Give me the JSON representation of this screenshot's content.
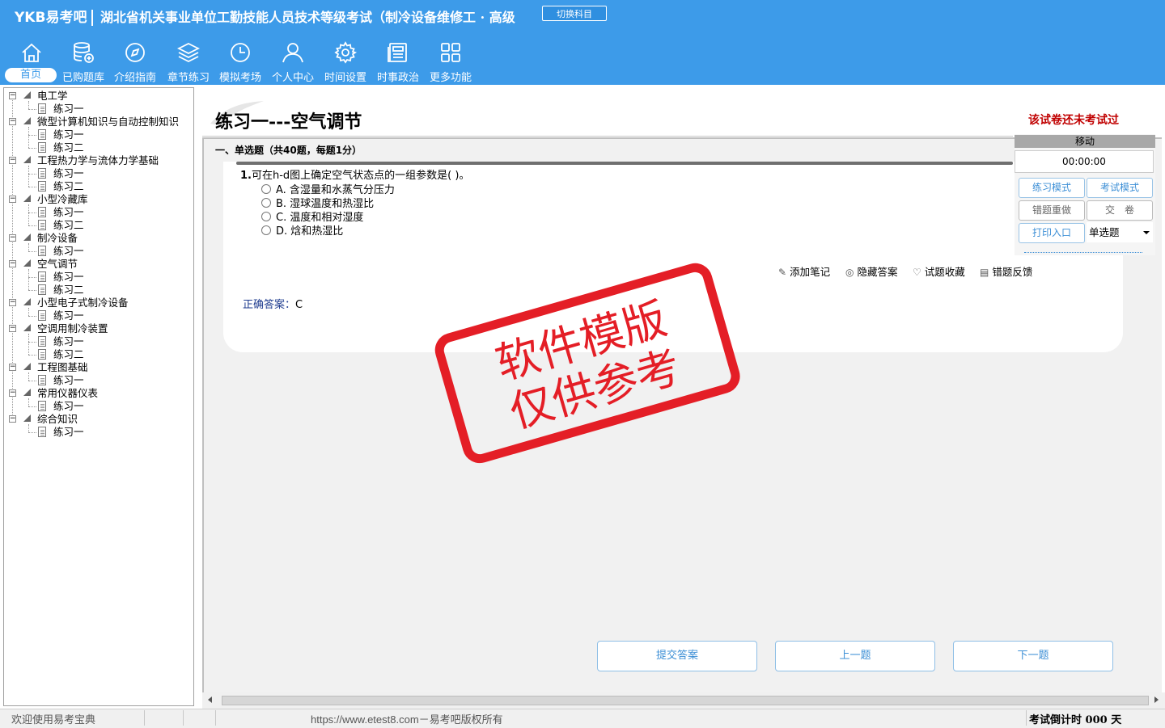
{
  "header": {
    "brand": "YKB易考吧",
    "exam_title": "湖北省机关事业单位工勤技能人员技术等级考试（制冷设备维修工 · 高级",
    "switch_label": "切换科目",
    "nav": [
      {
        "label": "首页",
        "icon": "home-icon"
      },
      {
        "label": "已购题库",
        "icon": "database-icon"
      },
      {
        "label": "介绍指南",
        "icon": "compass-icon"
      },
      {
        "label": "章节练习",
        "icon": "layers-icon"
      },
      {
        "label": "模拟考场",
        "icon": "clock-icon"
      },
      {
        "label": "个人中心",
        "icon": "user-icon"
      },
      {
        "label": "时间设置",
        "icon": "gear-icon"
      },
      {
        "label": "时事政治",
        "icon": "newspaper-icon"
      },
      {
        "label": "更多功能",
        "icon": "grid-icon"
      }
    ]
  },
  "tree": [
    {
      "label": "电工学",
      "children": [
        "练习一"
      ]
    },
    {
      "label": "微型计算机知识与自动控制知识",
      "children": [
        "练习一",
        "练习二"
      ]
    },
    {
      "label": "工程热力学与流体力学基础",
      "children": [
        "练习一",
        "练习二"
      ]
    },
    {
      "label": "小型冷藏库",
      "children": [
        "练习一",
        "练习二"
      ]
    },
    {
      "label": "制冷设备",
      "children": [
        "练习一"
      ]
    },
    {
      "label": "空气调节",
      "children": [
        "练习一",
        "练习二"
      ]
    },
    {
      "label": "小型电子式制冷设备",
      "children": [
        "练习一"
      ]
    },
    {
      "label": "空调用制冷装置",
      "children": [
        "练习一",
        "练习二"
      ]
    },
    {
      "label": "工程图基础",
      "children": [
        "练习一"
      ]
    },
    {
      "label": "常用仪器仪表",
      "children": [
        "练习一"
      ]
    },
    {
      "label": "综合知识",
      "children": [
        "练习一"
      ]
    }
  ],
  "main": {
    "title": "练习一---空气调节",
    "not_taken": "该试卷还未考试过",
    "section": "一、单选题（共40题，每题1分）",
    "question": {
      "number": "1.",
      "stem": "可在h-d图上确定空气状态点的一组参数是( )。",
      "options": [
        "A. 含湿量和水蒸气分压力",
        "B. 湿球温度和热湿比",
        "C. 温度和相对湿度",
        "D. 焓和热湿比"
      ]
    },
    "tools": [
      "添加笔记",
      "隐藏答案",
      "试题收藏",
      "错题反馈"
    ],
    "answer_label": "正确答案：",
    "answer_value": "C",
    "stamp_line1": "软件模版",
    "stamp_line2": "仅供参考",
    "buttons": {
      "submit": "提交答案",
      "prev": "上一题",
      "next": "下一题"
    }
  },
  "control": {
    "move": "移动",
    "timer": "00:00:00",
    "practice_mode": "练习模式",
    "exam_mode": "考试模式",
    "redo_wrong": "错题重做",
    "submit_paper": "交　卷",
    "print": "打印入口",
    "question_type": "单选题"
  },
  "status": {
    "welcome": "欢迎使用易考宝典",
    "copyright": "https://www.etest8.com－易考吧版权所有",
    "countdown": "考试倒计时 000 天"
  },
  "colors": {
    "header_bg": "#3d9be9",
    "accent": "#3d8fd6",
    "warning": "#c00000",
    "stamp": "#e41e26"
  }
}
